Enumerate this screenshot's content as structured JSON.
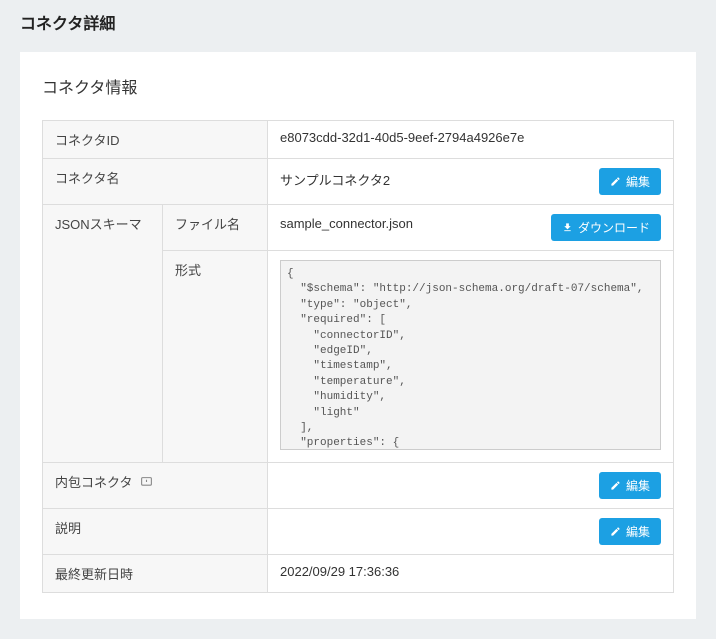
{
  "page": {
    "title": "コネクタ詳細"
  },
  "card": {
    "title": "コネクタ情報"
  },
  "labels": {
    "connector_id": "コネクタID",
    "connector_name": "コネクタ名",
    "json_schema": "JSONスキーマ",
    "file_name": "ファイル名",
    "format": "形式",
    "inner_connector": "内包コネクタ",
    "description": "説明",
    "last_updated": "最終更新日時"
  },
  "values": {
    "connector_id": "e8073cdd-32d1-40d5-9eef-2794a4926e7e",
    "connector_name": "サンプルコネクタ2",
    "file_name": "sample_connector.json",
    "schema_format": "{\n  \"$schema\": \"http://json-schema.org/draft-07/schema\",\n  \"type\": \"object\",\n  \"required\": [\n    \"connectorID\",\n    \"edgeID\",\n    \"timestamp\",\n    \"temperature\",\n    \"humidity\",\n    \"light\"\n  ],\n  \"properties\": {\n    \"connectorID\": {\n      \"type\": \"string\"\n    }",
    "inner_connector": "",
    "description": "",
    "last_updated": "2022/09/29 17:36:36"
  },
  "buttons": {
    "edit": "編集",
    "download": "ダウンロード"
  }
}
